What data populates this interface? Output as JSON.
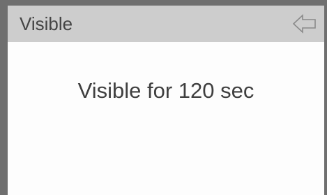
{
  "header": {
    "title": "Visible",
    "back_icon": "left-arrow-outline-icon"
  },
  "main": {
    "message": "Visible for 120 sec"
  },
  "colors": {
    "frame": "#6f6f6f",
    "title_bar": "#cdcdcd",
    "background": "#fdfdfd",
    "text": "#444444"
  }
}
